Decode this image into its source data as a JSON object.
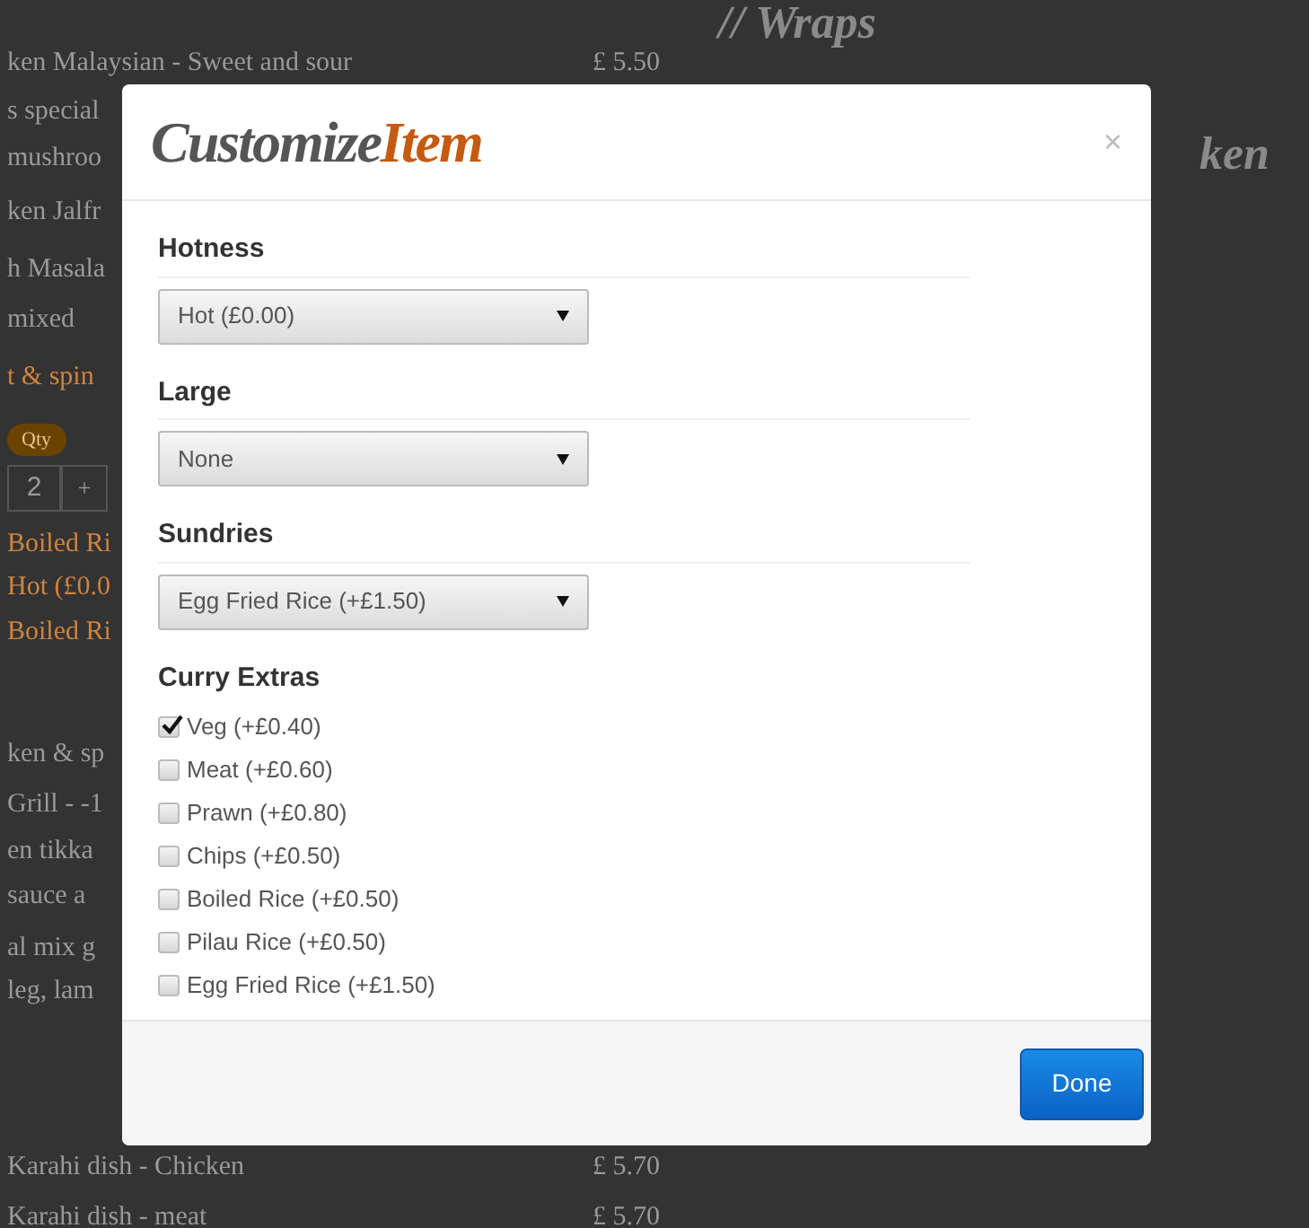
{
  "background": {
    "heading": "// Wraps",
    "side_heading": "ken",
    "items": [
      {
        "kind": "priced",
        "text": "ken Malaysian - Sweet and sour",
        "price": "£ 5.50"
      },
      {
        "kind": "text",
        "text": "s special"
      },
      {
        "kind": "text",
        "text": "mushroo"
      },
      {
        "kind": "text",
        "text": "ken Jalfr"
      },
      {
        "kind": "text",
        "text": "h Masala"
      },
      {
        "kind": "text",
        "text": "mixed"
      },
      {
        "kind": "accent",
        "text": "t & spin"
      },
      {
        "kind": "badge",
        "text": "Qty"
      },
      {
        "kind": "qty",
        "text": "2",
        "plus": "+"
      },
      {
        "kind": "accent",
        "text": "Boiled Ri"
      },
      {
        "kind": "accent",
        "text": "Hot (£0.0"
      },
      {
        "kind": "accent",
        "text": "Boiled Ri"
      },
      {
        "kind": "text",
        "text": "ken & sp"
      },
      {
        "kind": "text",
        "text": "Grill - -1"
      },
      {
        "kind": "text",
        "text": "en tikka"
      },
      {
        "kind": "text",
        "text": "sauce a"
      },
      {
        "kind": "text",
        "text": "al mix g"
      },
      {
        "kind": "text",
        "text": "leg, lam"
      },
      {
        "kind": "priced",
        "text": "Karahi dish - Chicken",
        "price": "£ 5.70"
      },
      {
        "kind": "priced",
        "text": "Karahi dish - meat",
        "price": "£ 5.70"
      }
    ]
  },
  "dialog": {
    "title": {
      "main": "Customize",
      "accent": "Item"
    },
    "close": "×",
    "selects": [
      {
        "label": "Hotness",
        "value": "Hot (£0.00)"
      },
      {
        "label": "Large",
        "value": "None"
      },
      {
        "label": "Sundries",
        "value": "Egg Fried Rice (+£1.50)"
      }
    ],
    "extras": {
      "label": "Curry Extras",
      "options": [
        {
          "label": "Veg (+£0.40)",
          "checked": true
        },
        {
          "label": "Meat (+£0.60)",
          "checked": false
        },
        {
          "label": "Prawn (+£0.80)",
          "checked": false
        },
        {
          "label": "Chips (+£0.50)",
          "checked": false
        },
        {
          "label": "Boiled Rice (+£0.50)",
          "checked": false
        },
        {
          "label": "Pilau Rice (+£0.50)",
          "checked": false
        },
        {
          "label": "Egg Fried Rice (+£1.50)",
          "checked": false
        }
      ]
    },
    "done": "Done"
  }
}
